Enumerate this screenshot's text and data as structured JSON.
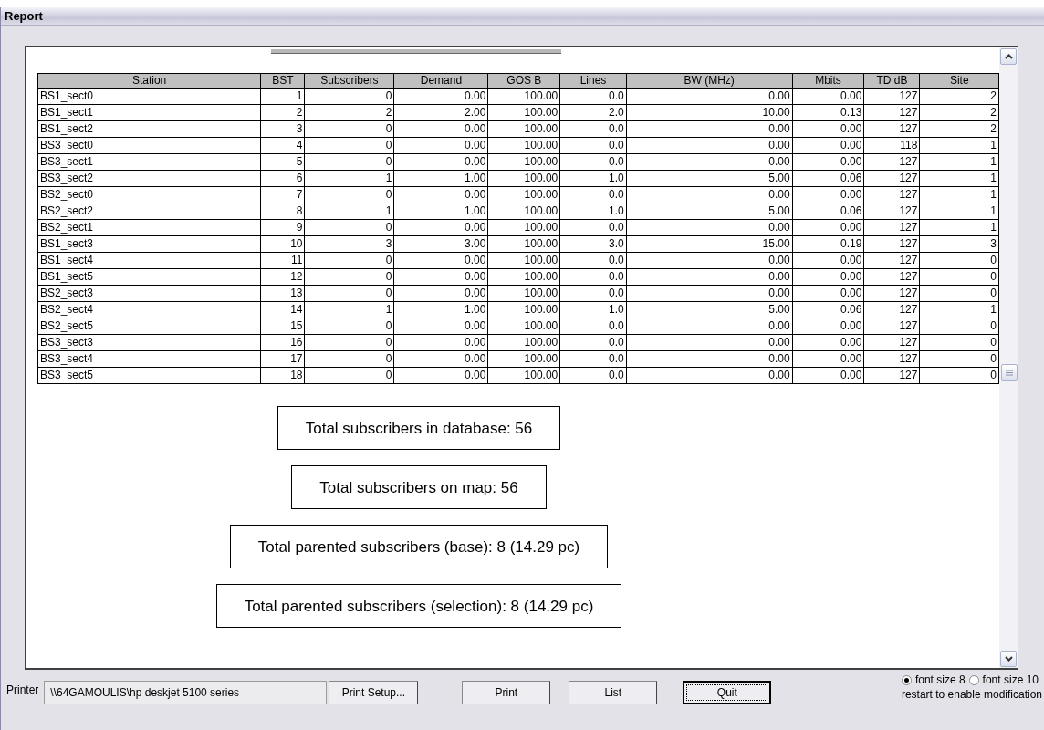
{
  "window": {
    "title": "Report"
  },
  "table": {
    "columns": [
      "Station",
      "BST",
      "Subscribers",
      "Demand",
      "GOS B",
      "Lines",
      "BW (MHz)",
      "Mbits",
      "TD dB",
      "Site"
    ],
    "rows": [
      [
        "BS1_sect0",
        "1",
        "0",
        "0.00",
        "100.00",
        "0.0",
        "0.00",
        "0.00",
        "127",
        "2"
      ],
      [
        "BS1_sect1",
        "2",
        "2",
        "2.00",
        "100.00",
        "2.0",
        "10.00",
        "0.13",
        "127",
        "2"
      ],
      [
        "BS1_sect2",
        "3",
        "0",
        "0.00",
        "100.00",
        "0.0",
        "0.00",
        "0.00",
        "127",
        "2"
      ],
      [
        "BS3_sect0",
        "4",
        "0",
        "0.00",
        "100.00",
        "0.0",
        "0.00",
        "0.00",
        "118",
        "1"
      ],
      [
        "BS3_sect1",
        "5",
        "0",
        "0.00",
        "100.00",
        "0.0",
        "0.00",
        "0.00",
        "127",
        "1"
      ],
      [
        "BS3_sect2",
        "6",
        "1",
        "1.00",
        "100.00",
        "1.0",
        "5.00",
        "0.06",
        "127",
        "1"
      ],
      [
        "BS2_sect0",
        "7",
        "0",
        "0.00",
        "100.00",
        "0.0",
        "0.00",
        "0.00",
        "127",
        "1"
      ],
      [
        "BS2_sect2",
        "8",
        "1",
        "1.00",
        "100.00",
        "1.0",
        "5.00",
        "0.06",
        "127",
        "1"
      ],
      [
        "BS2_sect1",
        "9",
        "0",
        "0.00",
        "100.00",
        "0.0",
        "0.00",
        "0.00",
        "127",
        "1"
      ],
      [
        "BS1_sect3",
        "10",
        "3",
        "3.00",
        "100.00",
        "3.0",
        "15.00",
        "0.19",
        "127",
        "3"
      ],
      [
        "BS1_sect4",
        "11",
        "0",
        "0.00",
        "100.00",
        "0.0",
        "0.00",
        "0.00",
        "127",
        "0"
      ],
      [
        "BS1_sect5",
        "12",
        "0",
        "0.00",
        "100.00",
        "0.0",
        "0.00",
        "0.00",
        "127",
        "0"
      ],
      [
        "BS2_sect3",
        "13",
        "0",
        "0.00",
        "100.00",
        "0.0",
        "0.00",
        "0.00",
        "127",
        "0"
      ],
      [
        "BS2_sect4",
        "14",
        "1",
        "1.00",
        "100.00",
        "1.0",
        "5.00",
        "0.06",
        "127",
        "1"
      ],
      [
        "BS2_sect5",
        "15",
        "0",
        "0.00",
        "100.00",
        "0.0",
        "0.00",
        "0.00",
        "127",
        "0"
      ],
      [
        "BS3_sect3",
        "16",
        "0",
        "0.00",
        "100.00",
        "0.0",
        "0.00",
        "0.00",
        "127",
        "0"
      ],
      [
        "BS3_sect4",
        "17",
        "0",
        "0.00",
        "100.00",
        "0.0",
        "0.00",
        "0.00",
        "127",
        "0"
      ],
      [
        "BS3_sect5",
        "18",
        "0",
        "0.00",
        "100.00",
        "0.0",
        "0.00",
        "0.00",
        "127",
        "0"
      ]
    ]
  },
  "totals": [
    "Total subscribers in database: 56",
    "Total subscribers on map: 56",
    "Total parented subscribers (base): 8 (14.29 pc)",
    "Total parented subscribers (selection): 8 (14.29 pc)"
  ],
  "printer": {
    "label": "Printer",
    "value": "\\\\64GAMOULIS\\hp deskjet 5100 series"
  },
  "buttons": [
    "Print Setup...",
    "Print",
    "List",
    "Quit"
  ],
  "font_options": [
    {
      "label": "font size 8",
      "selected": true
    },
    {
      "label": "font size 10",
      "selected": false
    }
  ],
  "note": "restart to enable modification"
}
